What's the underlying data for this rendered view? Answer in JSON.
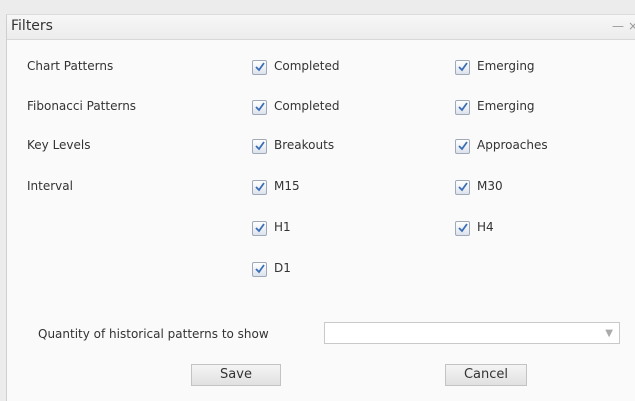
{
  "window": {
    "title": "Filters",
    "minimize_glyph": "—",
    "close_glyph": "×"
  },
  "filters": {
    "chart_patterns": {
      "label": "Chart Patterns",
      "options": [
        {
          "label": "Completed",
          "checked": true
        },
        {
          "label": "Emerging",
          "checked": true
        }
      ]
    },
    "fibonacci_patterns": {
      "label": "Fibonacci Patterns",
      "options": [
        {
          "label": "Completed",
          "checked": true
        },
        {
          "label": "Emerging",
          "checked": true
        }
      ]
    },
    "key_levels": {
      "label": "Key Levels",
      "options": [
        {
          "label": "Breakouts",
          "checked": true
        },
        {
          "label": "Approaches",
          "checked": true
        }
      ]
    },
    "interval": {
      "label": "Interval",
      "options": [
        {
          "label": "M15",
          "checked": true
        },
        {
          "label": "M30",
          "checked": true
        },
        {
          "label": "H1",
          "checked": true
        },
        {
          "label": "H4",
          "checked": true
        },
        {
          "label": "D1",
          "checked": true
        }
      ]
    }
  },
  "quantity": {
    "label": "Quantity of historical patterns to show",
    "value": ""
  },
  "buttons": {
    "save": "Save",
    "cancel": "Cancel"
  },
  "icons": {
    "checkmark": "checkmark-icon",
    "dropdown": "chevron-down-icon"
  },
  "colors": {
    "checkmark": "#3a6fb8"
  }
}
